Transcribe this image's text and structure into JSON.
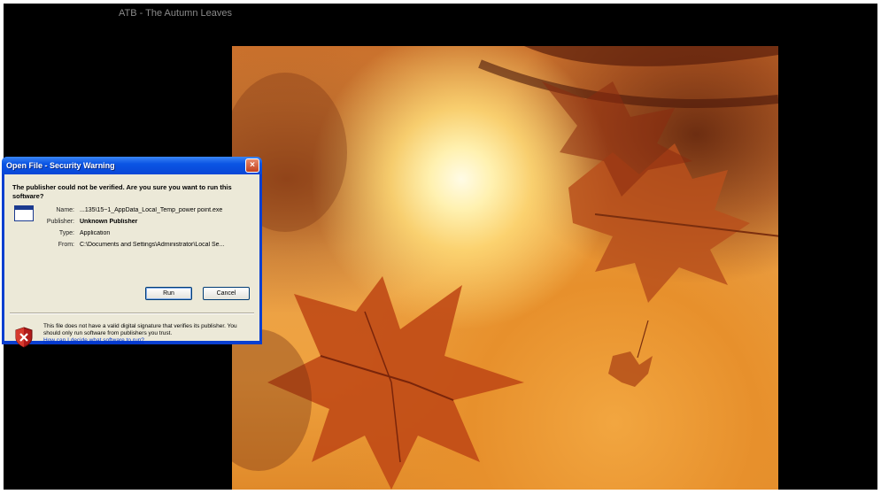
{
  "window": {
    "title": "ATB - The Autumn Leaves"
  },
  "dialog": {
    "title": "Open File - Security Warning",
    "close_label": "×",
    "question": "The publisher could not be verified.  Are you sure you want to run this software?",
    "fields": [
      {
        "label": "Name:",
        "value": "...135\\15~1_AppData_Local_Temp_power point.exe",
        "bold": false
      },
      {
        "label": "Publisher:",
        "value": "Unknown Publisher",
        "bold": true
      },
      {
        "label": "Type:",
        "value": "Application",
        "bold": false
      },
      {
        "label": "From:",
        "value": "C:\\Documents and Settings\\Administrator\\Local Se...",
        "bold": false
      }
    ],
    "run_label": "Run",
    "cancel_label": "Cancel",
    "warning_text": "This file does not have a valid digital signature that verifies its publisher.  You should only run software from publishers you trust.",
    "help_link": "How can I decide what software to run?"
  },
  "icons": [
    "application-icon",
    "shield-warning-icon",
    "close-icon"
  ]
}
